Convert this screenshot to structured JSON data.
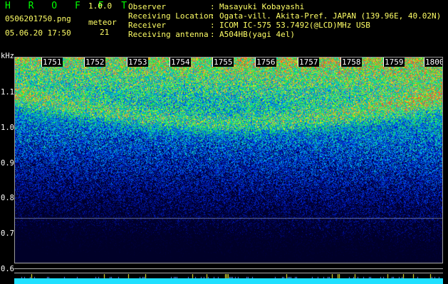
{
  "header": {
    "title": "H R O F F T",
    "version": "1.0.0",
    "file_name": "0506201750.png",
    "datetime": "05.06.20 17:50",
    "meteor_label": "meteor",
    "meteor_count": "21"
  },
  "info": [
    {
      "key": "Observer",
      "value": "Masayuki Kobayashi"
    },
    {
      "key": "Receiving Location",
      "value": "Ogata-vill. Akita-Pref. JAPAN (139.96E, 40.02N)"
    },
    {
      "key": "Receiver",
      "value": "ICOM IC-575 53.7492(@LCD)MHz USB"
    },
    {
      "key": "Receiving antenna",
      "value": "A504HB(yagi 4el)"
    }
  ],
  "separator": ":",
  "spectrogram": {
    "unit": "kHz",
    "time_labels": [
      "1751",
      "1752",
      "1753",
      "1754",
      "1755",
      "1756",
      "1757",
      "1758",
      "1759",
      "1800"
    ],
    "freq_ticks": [
      "1.1",
      "1.0",
      "0.9",
      "0.8",
      "0.7",
      "0.6"
    ]
  },
  "colors": {
    "text_yellow": "#ffff66",
    "title_green": "#00ff00",
    "axis_white": "#ffffff",
    "frame_gray": "#9a9a9a",
    "strip_cyan": "#20e0ff"
  }
}
